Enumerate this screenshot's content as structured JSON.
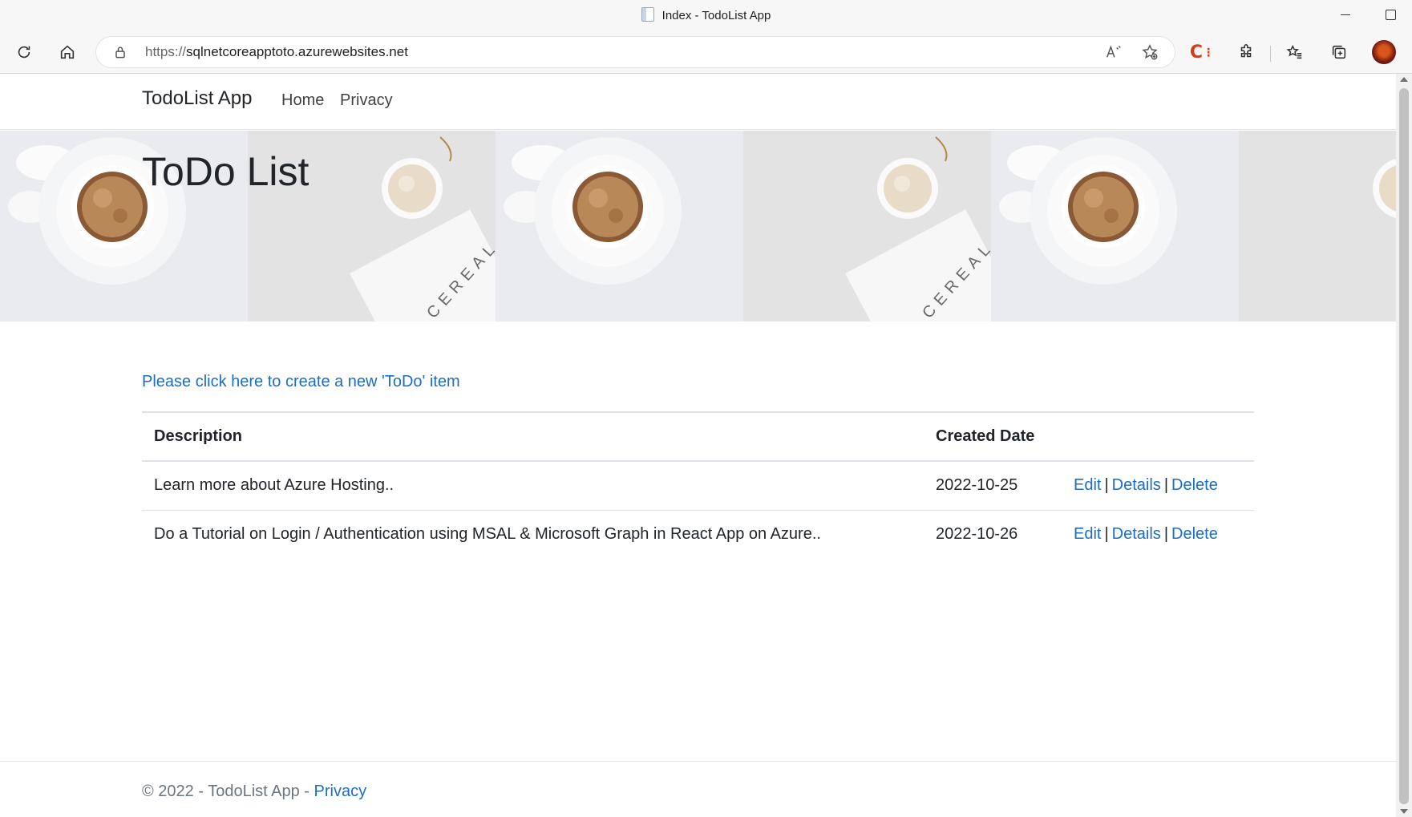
{
  "browser": {
    "tab_title": "Index - TodoList App",
    "url_protocol": "https://",
    "url_host": "sqlnetcoreapptoto.azurewebsites.net",
    "icons": [
      "refresh-icon",
      "home-icon",
      "lock-icon",
      "read-aloud-icon",
      "add-favorite-icon",
      "extension-c-icon",
      "extensions-icon",
      "favorites-icon",
      "collections-icon",
      "profile-avatar"
    ]
  },
  "nav": {
    "brand": "TodoList App",
    "links": [
      {
        "label": "Home"
      },
      {
        "label": "Privacy"
      }
    ]
  },
  "hero": {
    "title": "ToDo List",
    "image_text": "CEREAL"
  },
  "main": {
    "create_link": "Please click here to create a new 'ToDo' item",
    "table": {
      "headers": [
        "Description",
        "Created Date",
        ""
      ],
      "rows": [
        {
          "description": "Learn more about Azure Hosting..",
          "created": "2022-10-25",
          "edit": "Edit",
          "details": "Details",
          "delete": "Delete"
        },
        {
          "description": "Do a Tutorial on Login / Authentication using MSAL & Microsoft Graph in React App on Azure..",
          "created": "2022-10-26",
          "edit": "Edit",
          "details": "Details",
          "delete": "Delete"
        }
      ],
      "separator": "|"
    }
  },
  "footer": {
    "prefix": "© 2022 - TodoList App - ",
    "privacy": "Privacy"
  },
  "colors": {
    "link": "#1b6ec2",
    "text": "#212529",
    "muted": "#6c757d"
  }
}
